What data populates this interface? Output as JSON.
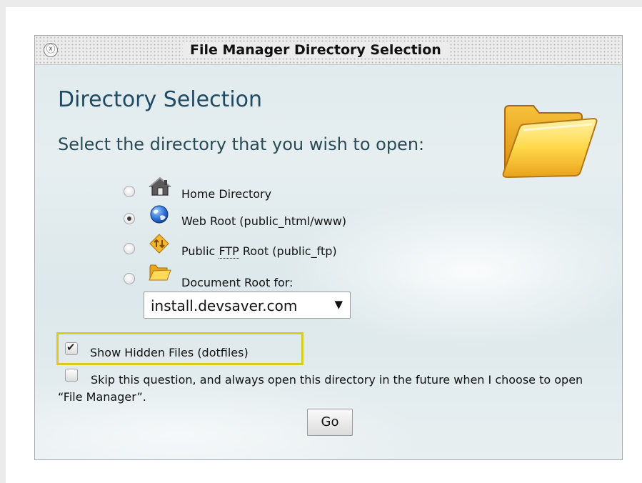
{
  "dialog": {
    "title": "File Manager Directory Selection",
    "close_glyph": "ⓧ",
    "heading": "Directory Selection",
    "prompt": "Select the directory that you wish to open:"
  },
  "options": [
    {
      "label_before": "",
      "label_abbr": "",
      "label_after": "Home Directory",
      "icon": "home-icon",
      "selected": false
    },
    {
      "label_before": "",
      "label_abbr": "",
      "label_after": "Web Root (public_html/www)",
      "icon": "globe-icon",
      "selected": true
    },
    {
      "label_before": "Public ",
      "label_abbr": "FTP",
      "label_after": " Root (public_ftp)",
      "icon": "ftp-icon",
      "selected": false
    },
    {
      "label_before": "",
      "label_abbr": "",
      "label_after": "Document Root for:",
      "icon": "folder-icon",
      "selected": false
    }
  ],
  "domain_select": {
    "value": "install.devsaver.com",
    "arrow": "▼"
  },
  "show_hidden": {
    "label": "Show Hidden Files (dotfiles)",
    "checked": true,
    "check_glyph": "✔",
    "highlight_color": "#d8cc22"
  },
  "skip_question": {
    "label": "Skip this question, and always open this directory in the future when I choose to open “File Manager”.",
    "checked": false
  },
  "go_button": {
    "label": "Go"
  },
  "colors": {
    "heading": "#1f4a63",
    "dialog_background": "#e3ecee"
  }
}
